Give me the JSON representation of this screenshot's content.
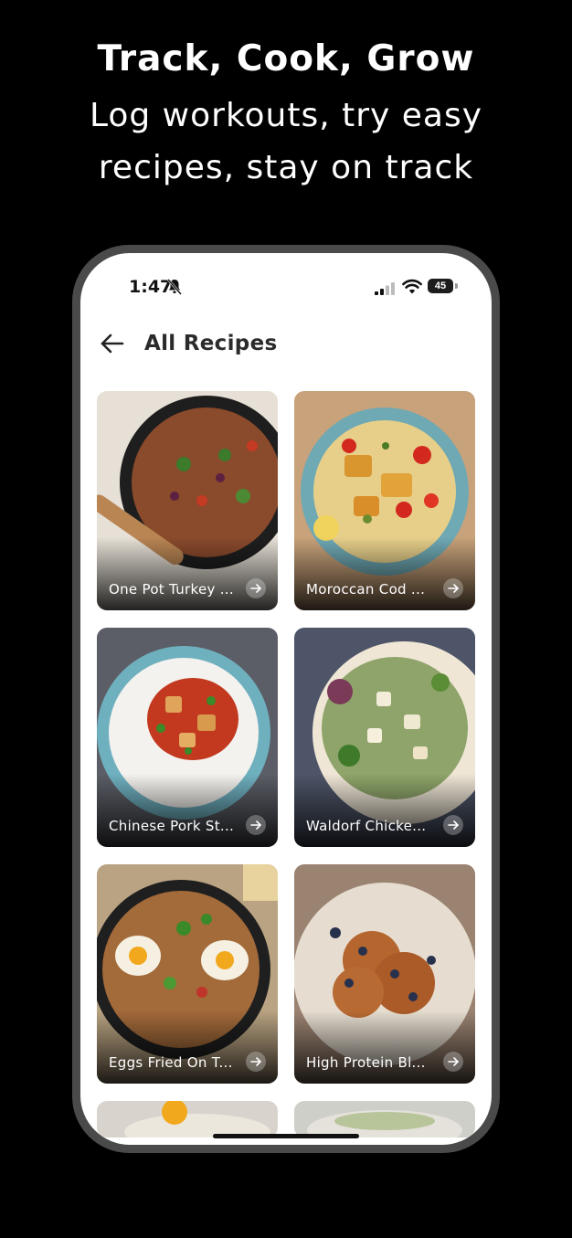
{
  "promo": {
    "title": "Track, Cook, Grow",
    "subtitle_line1": "Log workouts, try easy",
    "subtitle_line2": "recipes, stay on track"
  },
  "status_bar": {
    "time": "1:47",
    "battery": "45",
    "icons": [
      "bell-slash-icon",
      "signal-icon",
      "wifi-icon",
      "battery-icon"
    ]
  },
  "header": {
    "title": "All Recipes",
    "back_icon": "arrow-left-icon"
  },
  "recipes": [
    {
      "label": "One Pot Turkey ...",
      "color": "#8a4a2c"
    },
    {
      "label": "Moroccan Cod ...",
      "color": "#c9a35a"
    },
    {
      "label": "Chinese Pork St...",
      "color": "#c23a22"
    },
    {
      "label": "Waldorf Chicke...",
      "color": "#8ea46a"
    },
    {
      "label": "Eggs Fried On T...",
      "color": "#a36a3a"
    },
    {
      "label": "High Protein Bl...",
      "color": "#b5652e"
    }
  ],
  "colors": {
    "phone_frame": "#4a4a4a",
    "background": "#000000",
    "screen": "#ffffff"
  }
}
